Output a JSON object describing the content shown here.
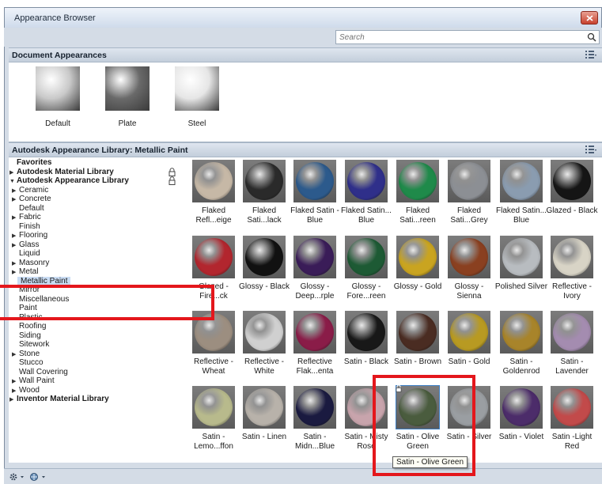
{
  "window": {
    "title": "Appearance Browser"
  },
  "search": {
    "placeholder": "Search"
  },
  "document_section": {
    "header": "Document Appearances",
    "items": [
      {
        "label": "Default",
        "swatch": "#c9c9c9"
      },
      {
        "label": "Plate",
        "swatch": "#6a6a6a"
      },
      {
        "label": "Steel",
        "swatch": "#e6e6e6"
      }
    ]
  },
  "library_section": {
    "header": "Autodesk Appearance Library: Metallic Paint"
  },
  "tree": [
    {
      "label": "Favorites",
      "bold": true,
      "arrow": "",
      "indent": 0,
      "lock": false
    },
    {
      "label": "Autodesk Material Library",
      "bold": true,
      "arrow": "▶",
      "indent": 0,
      "lock": true
    },
    {
      "label": "Autodesk Appearance Library",
      "bold": true,
      "arrow": "▼",
      "indent": 0,
      "lock": true
    },
    {
      "label": "Ceramic",
      "bold": false,
      "arrow": "▶",
      "indent": 1,
      "lock": false
    },
    {
      "label": "Concrete",
      "bold": false,
      "arrow": "▶",
      "indent": 1,
      "lock": false
    },
    {
      "label": "Default",
      "bold": false,
      "arrow": "",
      "indent": 1,
      "lock": false
    },
    {
      "label": "Fabric",
      "bold": false,
      "arrow": "▶",
      "indent": 1,
      "lock": false
    },
    {
      "label": "Finish",
      "bold": false,
      "arrow": "",
      "indent": 1,
      "lock": false
    },
    {
      "label": "Flooring",
      "bold": false,
      "arrow": "▶",
      "indent": 1,
      "lock": false
    },
    {
      "label": "Glass",
      "bold": false,
      "arrow": "▶",
      "indent": 1,
      "lock": false
    },
    {
      "label": "Liquid",
      "bold": false,
      "arrow": "",
      "indent": 1,
      "lock": false
    },
    {
      "label": "Masonry",
      "bold": false,
      "arrow": "▶",
      "indent": 1,
      "lock": false
    },
    {
      "label": "Metal",
      "bold": false,
      "arrow": "▶",
      "indent": 1,
      "lock": false
    },
    {
      "label": "Metallic Paint",
      "bold": false,
      "arrow": "",
      "indent": 1,
      "lock": false,
      "selected": true
    },
    {
      "label": "Mirror",
      "bold": false,
      "arrow": "",
      "indent": 1,
      "lock": false
    },
    {
      "label": "Miscellaneous",
      "bold": false,
      "arrow": "",
      "indent": 1,
      "lock": false
    },
    {
      "label": "Paint",
      "bold": false,
      "arrow": "",
      "indent": 1,
      "lock": false
    },
    {
      "label": "Plastic",
      "bold": false,
      "arrow": "",
      "indent": 1,
      "lock": false
    },
    {
      "label": "Roofing",
      "bold": false,
      "arrow": "",
      "indent": 1,
      "lock": false
    },
    {
      "label": "Siding",
      "bold": false,
      "arrow": "",
      "indent": 1,
      "lock": false
    },
    {
      "label": "Sitework",
      "bold": false,
      "arrow": "",
      "indent": 1,
      "lock": false
    },
    {
      "label": "Stone",
      "bold": false,
      "arrow": "▶",
      "indent": 1,
      "lock": false
    },
    {
      "label": "Stucco",
      "bold": false,
      "arrow": "",
      "indent": 1,
      "lock": false
    },
    {
      "label": "Wall Covering",
      "bold": false,
      "arrow": "",
      "indent": 1,
      "lock": false
    },
    {
      "label": "Wall Paint",
      "bold": false,
      "arrow": "▶",
      "indent": 1,
      "lock": false
    },
    {
      "label": "Wood",
      "bold": false,
      "arrow": "▶",
      "indent": 1,
      "lock": false
    },
    {
      "label": "Inventor Material Library",
      "bold": true,
      "arrow": "▶",
      "indent": 0,
      "lock": false
    }
  ],
  "materials": [
    {
      "label": "Flaked Refl...eige",
      "color": "#c6b8a6"
    },
    {
      "label": "Flaked Sati...lack",
      "color": "#2a2a2a"
    },
    {
      "label": "Flaked Satin - Blue",
      "color": "#2c5a8c"
    },
    {
      "label": "Flaked Satin... Blue",
      "color": "#2f2f8a"
    },
    {
      "label": "Flaked Sati...reen",
      "color": "#1f8a4a"
    },
    {
      "label": "Flaked Sati...Grey",
      "color": "#8c8f94"
    },
    {
      "label": "Flaked Satin... Blue",
      "color": "#8a9cb0"
    },
    {
      "label": "Glazed - Black",
      "color": "#151515"
    },
    {
      "label": "Glazed - Fire...ck",
      "color": "#b2262e"
    },
    {
      "label": "Glossy - Black",
      "color": "#111111"
    },
    {
      "label": "Glossy - Deep...rple",
      "color": "#3a1c58"
    },
    {
      "label": "Glossy - Fore...reen",
      "color": "#1d5a34"
    },
    {
      "label": "Glossy - Gold",
      "color": "#c9a420"
    },
    {
      "label": "Glossy - Sienna",
      "color": "#8a4020"
    },
    {
      "label": "Polished Silver",
      "color": "#b8bcc0"
    },
    {
      "label": "Reflective - Ivory",
      "color": "#d8d4c6"
    },
    {
      "label": "Reflective - Wheat",
      "color": "#9c8e80"
    },
    {
      "label": "Reflective - White",
      "color": "#d0d0d0"
    },
    {
      "label": "Reflective Flak...enta",
      "color": "#8a1c48"
    },
    {
      "label": "Satin - Black",
      "color": "#181818"
    },
    {
      "label": "Satin - Brown",
      "color": "#4a2c22"
    },
    {
      "label": "Satin - Gold",
      "color": "#b89a22"
    },
    {
      "label": "Satin - Goldenrod",
      "color": "#a8842a"
    },
    {
      "label": "Satin - Lavender",
      "color": "#a48cb0"
    },
    {
      "label": "Satin - Lemo...ffon",
      "color": "#b8ba8c"
    },
    {
      "label": "Satin - Linen",
      "color": "#b8b2aa"
    },
    {
      "label": "Satin - Midn...Blue",
      "color": "#1a1a40"
    },
    {
      "label": "Satin - Misty Rose",
      "color": "#c8a4ac"
    },
    {
      "label": "Satin - Olive Green",
      "color": "#4a5c3e",
      "locked": true,
      "highlighted": true
    },
    {
      "label": "Satin - Silver",
      "color": "#9a9ea2"
    },
    {
      "label": "Satin - Violet",
      "color": "#4c2c6a"
    },
    {
      "label": "Satin -Light Red",
      "color": "#c24a4a"
    }
  ],
  "tooltip": {
    "text": "Satin - Olive Green"
  },
  "bottom_bar": {
    "icons": [
      "gear-icon",
      "library-icon"
    ]
  },
  "accent": {
    "highlight_box": "#e4171c",
    "selection": "#c9dcf3"
  }
}
